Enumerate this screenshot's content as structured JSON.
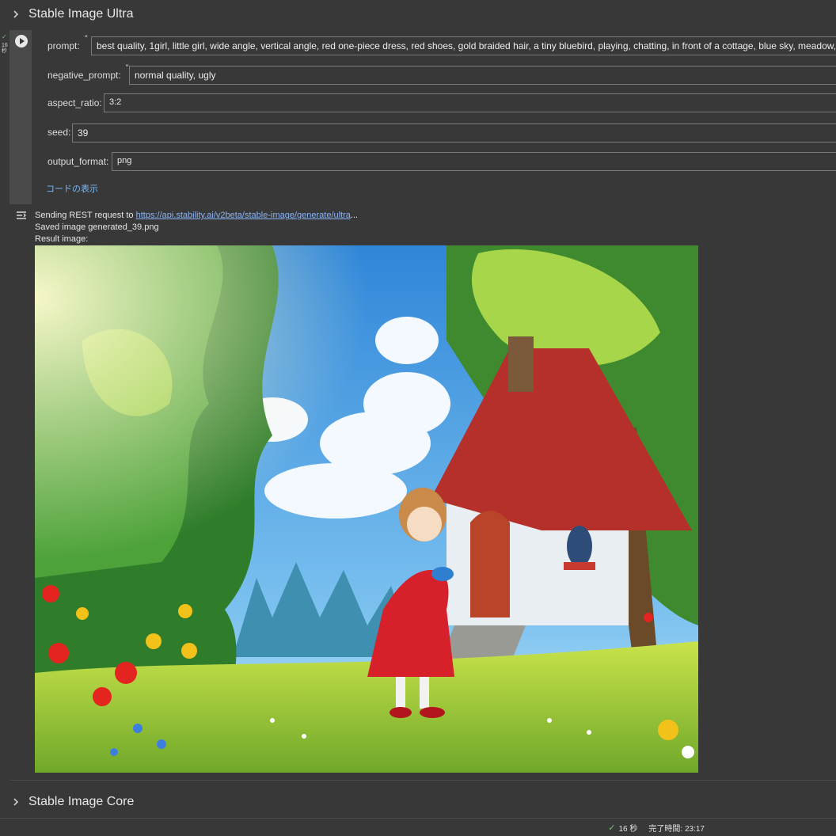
{
  "sections": {
    "ultra_title": "Stable Image Ultra",
    "core_title": "Stable Image Core"
  },
  "cell": {
    "exec_check": "✓",
    "exec_time": "16秒",
    "form": {
      "prompt_label": "prompt:",
      "prompt_value": "best quality, 1girl, little girl, wide angle, vertical angle, red one-piece dress, red shoes, gold braided hair, a tiny bluebird, playing, chatting, in front of a cottage, blue sky, meadow, forest, trees, rays",
      "negative_label": "negative_prompt:",
      "negative_value": "normal quality, ugly",
      "aspect_label": "aspect_ratio:",
      "aspect_value": "3:2",
      "seed_label": "seed:",
      "seed_value": "39",
      "format_label": "output_format:",
      "format_value": "png",
      "quote_mark": "\""
    },
    "show_code": "コードの表示"
  },
  "output": {
    "line1_prefix": "Sending REST request to ",
    "line1_link": "https://api.stability.ai/v2beta/stable-image/generate/ultra",
    "line1_suffix": "...",
    "line2": "Saved image generated_39.png",
    "line3": "Result image:"
  },
  "statusbar": {
    "check": "✓",
    "duration": "16 秒",
    "completed": "完了時間: 23:17"
  },
  "colors": {
    "background": "#383838",
    "link": "#8ab4f8",
    "success": "#7fbf7f"
  }
}
